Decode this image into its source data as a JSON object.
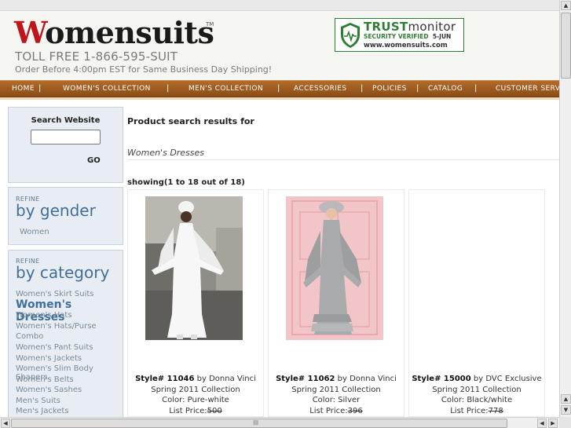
{
  "header": {
    "logo_mark": "W",
    "logo_rest": "omensuits",
    "logo_tm": "TM",
    "tollfree": "TOLL FREE 1-866-595-SUIT",
    "shipping": "Order Before 4:00pm EST for Same Business Day Shipping!",
    "trust": {
      "brand_bold": "TRUST",
      "brand_light": "monitor",
      "verified": "SECURITY VERIFIED",
      "date": "5-JUN",
      "url": "www.womensuits.com"
    }
  },
  "nav": {
    "items": [
      "HOME",
      "WOMEN'S COLLECTION",
      "MEN'S COLLECTION",
      "ACCESSORIES",
      "POLICIES",
      "CATALOG",
      "CUSTOMER SERV"
    ],
    "separator": "|"
  },
  "search": {
    "title": "Search Website",
    "value": "",
    "go_label": "GO"
  },
  "refine_gender": {
    "refine_label": "REFINE",
    "heading": "by gender",
    "items": [
      "Women"
    ]
  },
  "refine_category": {
    "refine_label": "REFINE",
    "heading": "by category",
    "items": [
      "Women's Skirt Suits",
      "Women's Dresses",
      "Women's Hats",
      "Women's Hats/Purse",
      "Combo",
      "Women's Pant Suits",
      "Women's Jackets",
      "Women's Slim Body Shapers",
      "Women's Belts",
      "Women's Sashes",
      "Men's Suits",
      "Men's Jackets"
    ],
    "active_index": 1
  },
  "results": {
    "title": "Product search results for",
    "query": "Women's Dresses",
    "showing": "showing(1 to 18 out of 18)"
  },
  "products": [
    {
      "style_label": "Style# 11046",
      "by": "by Donna Vinci",
      "collection": "Spring 2011 Collection",
      "color": "Color: Pure-white",
      "list_price_label": "List Price:",
      "list_price": "500"
    },
    {
      "style_label": "Style# 11062",
      "by": "by Donna Vinci",
      "collection": "Spring 2011 Collection",
      "color": "Color: Silver",
      "list_price_label": "List Price:",
      "list_price": "396"
    },
    {
      "style_label": "Style# 15000",
      "by": "by DVC Exclusive",
      "collection": "Spring 2011 Collection",
      "color": "Color: Black/white",
      "list_price_label": "List Price:",
      "list_price": "778"
    }
  ],
  "colors": {
    "nav_brown": "#9a5a20",
    "logo_red": "#c0141b",
    "trust_green": "#2e7d32",
    "refine_blue": "#3f6f9a"
  }
}
